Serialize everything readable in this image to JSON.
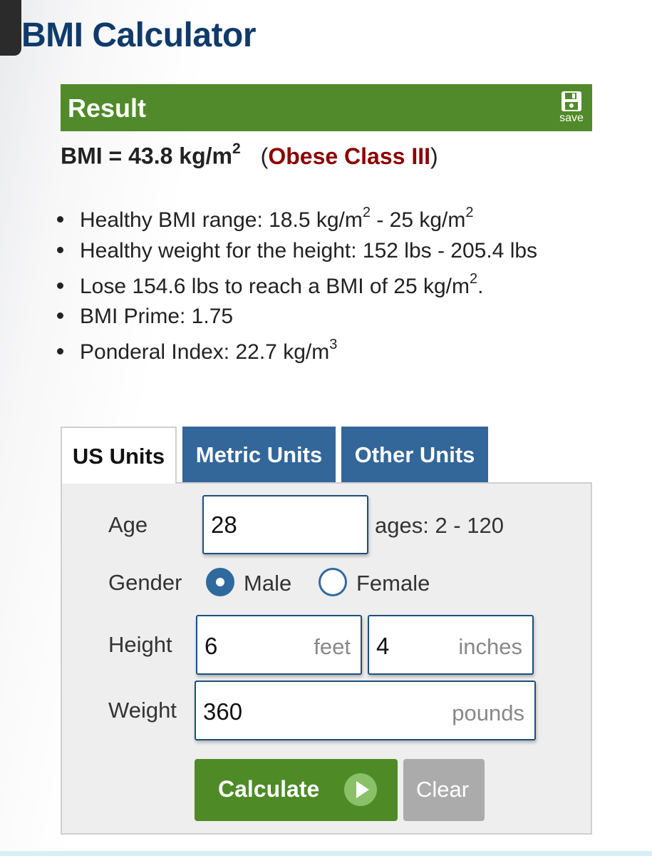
{
  "page": {
    "title": "BMI Calculator"
  },
  "result": {
    "header": "Result",
    "save_label": "save",
    "bmi_prefix": "BMI = 43.8 kg/m",
    "bmi_exp": "2",
    "classification": "Obese Class III",
    "colors": {
      "header_bg": "#518a2a",
      "classification": "#8b0000"
    },
    "stats": {
      "healthy_range": {
        "a": "Healthy BMI range: 18.5 kg/m",
        "b": "2",
        "c": " - 25 kg/m",
        "d": "2"
      },
      "healthy_weight": "Healthy weight for the height: 152 lbs - 205.4 lbs",
      "lose": {
        "a": "Lose 154.6 lbs to reach a BMI of 25 kg/m",
        "b": "2",
        "c": "."
      },
      "prime": "BMI Prime: 1.75",
      "ponderal": {
        "a": "Ponderal Index: 22.7 kg/m",
        "b": "3"
      }
    }
  },
  "tabs": [
    {
      "label": "US Units",
      "active": true
    },
    {
      "label": "Metric Units",
      "active": false
    },
    {
      "label": "Other Units",
      "active": false
    }
  ],
  "form": {
    "age": {
      "label": "Age",
      "value": "28",
      "hint": "ages: 2 - 120"
    },
    "gender": {
      "label": "Gender",
      "options": [
        "Male",
        "Female"
      ],
      "selected": "Male"
    },
    "height": {
      "label": "Height",
      "feet": "6",
      "feet_unit": "feet",
      "inches": "4",
      "inches_unit": "inches"
    },
    "weight": {
      "label": "Weight",
      "value": "360",
      "unit": "pounds"
    },
    "buttons": {
      "calculate": "Calculate",
      "clear": "Clear"
    }
  },
  "colors": {
    "title": "#0f3a6b",
    "tab_inactive": "#336699",
    "calculate": "#4e8a26",
    "clear": "#ababab"
  }
}
